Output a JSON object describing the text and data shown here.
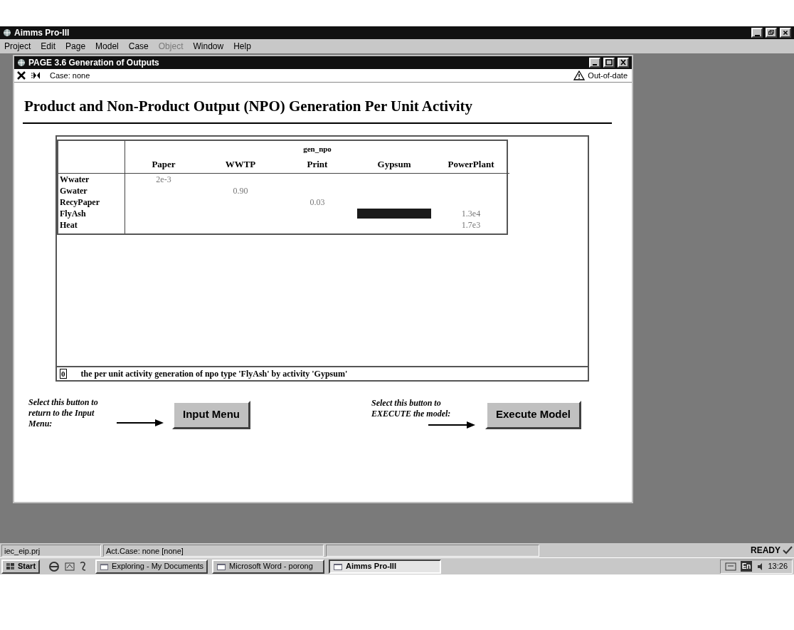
{
  "app_window": {
    "title": "Aimms Pro-III"
  },
  "menu": [
    {
      "label": "Project",
      "disabled": false
    },
    {
      "label": "Edit",
      "disabled": false
    },
    {
      "label": "Page",
      "disabled": false
    },
    {
      "label": "Model",
      "disabled": false
    },
    {
      "label": "Case",
      "disabled": false
    },
    {
      "label": "Object",
      "disabled": true
    },
    {
      "label": "Window",
      "disabled": false
    },
    {
      "label": "Help",
      "disabled": false
    }
  ],
  "page_window": {
    "title": "PAGE 3.6  Generation of Outputs",
    "case": "Case: none",
    "status": "Out-of-date"
  },
  "heading": "Product and Non-Product Output (NPO) Generation Per Unit Activity",
  "table": {
    "index_label": "gen_npo",
    "columns": [
      "Paper",
      "WWTP",
      "Print",
      "Gypsum",
      "PowerPlant"
    ],
    "rows": [
      {
        "label": "Wwater",
        "cells": [
          {
            "value": "2e-3",
            "selected": false
          },
          {
            "selected": false
          },
          {
            "selected": false
          },
          {
            "selected": false
          },
          {
            "selected": false
          }
        ]
      },
      {
        "label": "Gwater",
        "cells": [
          {
            "selected": false
          },
          {
            "value": "0.90",
            "selected": false
          },
          {
            "selected": false
          },
          {
            "selected": false
          },
          {
            "selected": false
          }
        ]
      },
      {
        "label": "RecyPaper",
        "cells": [
          {
            "selected": false
          },
          {
            "selected": false
          },
          {
            "value": "0.03",
            "selected": false
          },
          {
            "selected": false
          },
          {
            "selected": false
          }
        ]
      },
      {
        "label": "FlyAsh",
        "cells": [
          {
            "selected": false
          },
          {
            "selected": false
          },
          {
            "selected": false
          },
          {
            "selected": true
          },
          {
            "value": "1.3e4",
            "selected": false
          }
        ]
      },
      {
        "label": "Heat",
        "cells": [
          {
            "selected": false
          },
          {
            "selected": false
          },
          {
            "selected": false
          },
          {
            "selected": false
          },
          {
            "value": "1.7e3",
            "selected": false
          }
        ]
      }
    ],
    "edit_value": "0",
    "description": "the per unit activity generation of npo type 'FlyAsh' by activity 'Gypsum'"
  },
  "actions": [
    {
      "note": "Select this button to return to the Input Menu:",
      "button": "Input Menu"
    },
    {
      "note": "Select this button to EXECUTE the model:",
      "button": "Execute Model"
    }
  ],
  "status_bar": {
    "project": "iec_eip.prj",
    "case": "Act.Case: none  [none]",
    "state": "READY"
  },
  "taskbar": {
    "start": "Start",
    "tasks": [
      {
        "label": "Exploring - My Documents",
        "selected": false
      },
      {
        "label": "Microsoft Word - porong",
        "selected": false
      },
      {
        "label": "Aimms Pro-III",
        "selected": true
      }
    ],
    "clock": "13:26",
    "language": "En"
  }
}
